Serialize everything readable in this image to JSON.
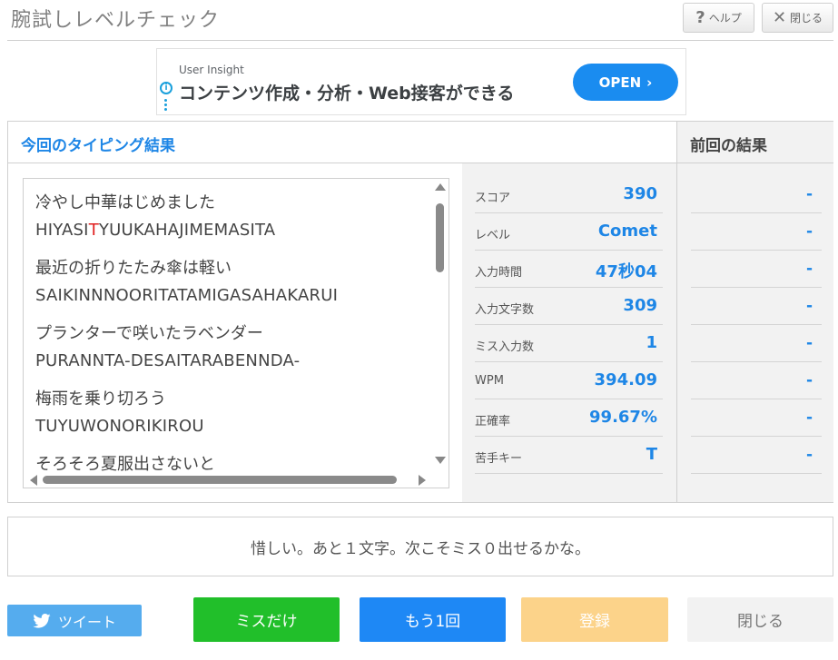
{
  "header": {
    "title": "腕試しレベルチェック",
    "help_label": "ヘルプ",
    "close_label": "閉じる"
  },
  "ad": {
    "source": "User Insight",
    "text": "コンテンツ作成・分析・Web接客ができる",
    "open_label": "OPEN"
  },
  "results": {
    "title": "今回のタイピング結果",
    "entries": [
      {
        "japanese": "冷やし中華はじめました",
        "romaji_before": "HIYASI",
        "romaji_miss": "T",
        "romaji_after": "YUUKAHAJIMEMASITA"
      },
      {
        "japanese": "最近の折りたたみ傘は軽い",
        "romaji": "SAIKINNNOORITATAMIGASAHAKARUI"
      },
      {
        "japanese": "プランターで咲いたラベンダー",
        "romaji": "PURANNTA-DESAITARABENNDA-"
      },
      {
        "japanese": "梅雨を乗り切ろう",
        "romaji": "TUYUWONORIKIROU"
      },
      {
        "japanese": "そろそろ夏服出さないと"
      }
    ],
    "stats": [
      {
        "label": "スコア",
        "value": "390"
      },
      {
        "label": "レベル",
        "value": "Comet"
      },
      {
        "label": "入力時間",
        "value": "47秒04"
      },
      {
        "label": "入力文字数",
        "value": "309"
      },
      {
        "label": "ミス入力数",
        "value": "1"
      },
      {
        "label": "WPM",
        "value": "394.09"
      },
      {
        "label": "正確率",
        "value": "99.67%"
      },
      {
        "label": "苦手キー",
        "value": "T"
      }
    ]
  },
  "previous": {
    "title": "前回の結果",
    "values": [
      "-",
      "-",
      "-",
      "-",
      "-",
      "-",
      "-",
      "-"
    ]
  },
  "message": "惜しい。あと１文字。次こそミス０出せるかな。",
  "buttons": {
    "tweet": "ツイート",
    "miss_only": "ミスだけ",
    "again": "もう1回",
    "register": "登録",
    "close": "閉じる"
  },
  "colors": {
    "accent_blue": "#1e86e6",
    "miss_red": "#e02020",
    "green": "#21bf2a",
    "orange_light": "#fcd38a",
    "twitter": "#55acee"
  }
}
